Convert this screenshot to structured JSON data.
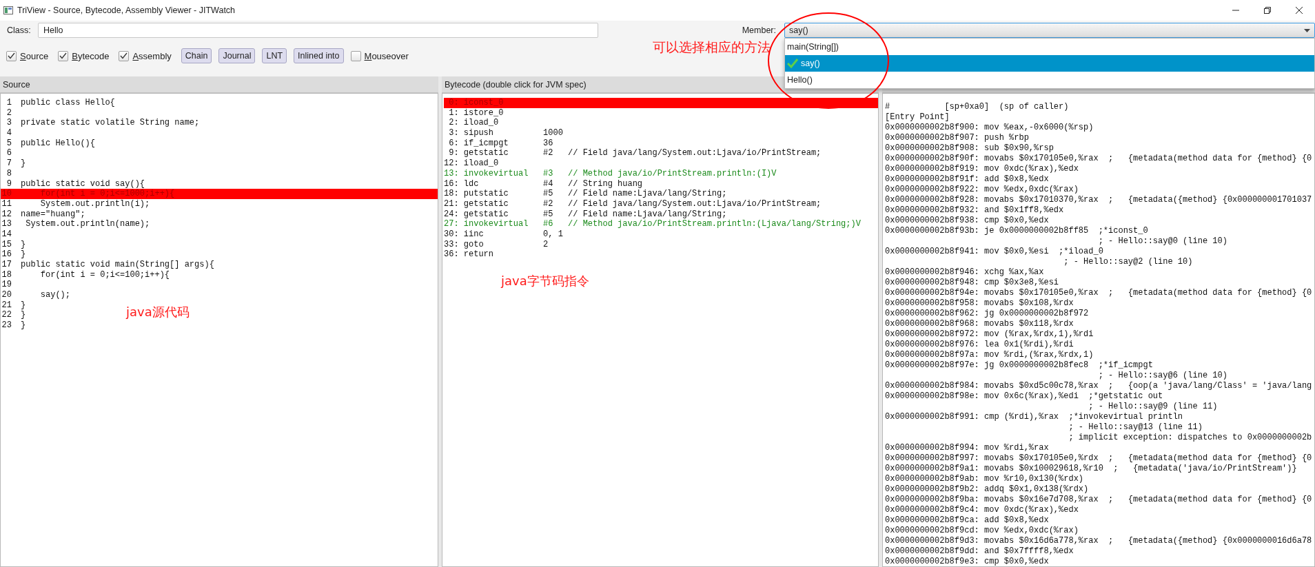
{
  "window": {
    "title": "TriView - Source, Bytecode, Assembly Viewer - JITWatch"
  },
  "class_field": {
    "label": "Class:",
    "value": "Hello"
  },
  "member": {
    "label": "Member:",
    "value": "say()",
    "expanded": true,
    "options": [
      {
        "label": "main(String[])",
        "selected": false
      },
      {
        "label": "say()",
        "selected": true
      },
      {
        "label": "Hello()",
        "selected": false
      }
    ]
  },
  "toolbar": [
    {
      "kind": "checkbox",
      "label": "Source",
      "checked": true
    },
    {
      "kind": "checkbox",
      "label": "Bytecode",
      "checked": true
    },
    {
      "kind": "checkbox",
      "label": "Assembly",
      "checked": true
    },
    {
      "kind": "button",
      "label": "Chain"
    },
    {
      "kind": "button",
      "label": "Journal"
    },
    {
      "kind": "button",
      "label": "LNT"
    },
    {
      "kind": "button",
      "label": "Inlined into"
    },
    {
      "kind": "checkbox",
      "label": "Mouseover",
      "checked": false
    }
  ],
  "annotation": {
    "text": "可以选择相应的方法"
  },
  "source": {
    "title": "Source",
    "note": "java源代码",
    "lines": [
      {
        "number": "1",
        "text": "public class Hello{",
        "highlighted": false
      },
      {
        "number": "2",
        "highlighted": false
      },
      {
        "number": "3",
        "text": "private static volatile String name;",
        "highlighted": false
      },
      {
        "number": "4",
        "highlighted": false
      },
      {
        "number": "5",
        "text": "public Hello(){",
        "highlighted": false
      },
      {
        "number": "6",
        "highlighted": false
      },
      {
        "number": "7",
        "text": "}",
        "highlighted": false
      },
      {
        "number": "8",
        "highlighted": false
      },
      {
        "number": "9",
        "text": "public static void say(){",
        "highlighted": false
      },
      {
        "number": "10",
        "text": "    for(int i = 0;i<=1000;i++){",
        "highlighted": true
      },
      {
        "number": "11",
        "text": "    System.out.println(i);",
        "highlighted": false
      },
      {
        "number": "12",
        "text": "name=\"huang\";",
        "highlighted": false
      },
      {
        "number": "13",
        "text": " System.out.println(name);",
        "highlighted": false
      },
      {
        "number": "14",
        "highlighted": false
      },
      {
        "number": "15",
        "text": "}",
        "highlighted": false
      },
      {
        "number": "16",
        "text": "}",
        "highlighted": false
      },
      {
        "number": "17",
        "text": "public static void main(String[] args){",
        "highlighted": false
      },
      {
        "number": "18",
        "text": "    for(int i = 0;i<=100;i++){",
        "highlighted": false
      },
      {
        "number": "19",
        "highlighted": false
      },
      {
        "number": "20",
        "text": "    say();",
        "highlighted": false
      },
      {
        "number": "21",
        "text": "}",
        "highlighted": false
      },
      {
        "number": "22",
        "text": "}",
        "highlighted": false
      },
      {
        "number": "23",
        "text": "}",
        "highlighted": false
      }
    ]
  },
  "bytecode": {
    "title": "Bytecode (double click for JVM spec)",
    "note": "java字节码指令",
    "lines": [
      {
        "text": " 0: iconst_0",
        "kind": "plain",
        "highlighted": true
      },
      {
        "text": " 1: istore_0",
        "kind": "plain",
        "highlighted": false
      },
      {
        "text": " 2: iload_0",
        "kind": "plain",
        "highlighted": false
      },
      {
        "text": " 3: sipush          1000",
        "kind": "plain",
        "highlighted": false
      },
      {
        "text": " 6: if_icmpgt       36",
        "kind": "plain",
        "highlighted": false
      },
      {
        "text": " 9: getstatic       #2   // Field java/lang/System.out:Ljava/io/PrintStream;",
        "kind": "plain",
        "highlighted": false
      },
      {
        "text": "12: iload_0",
        "kind": "plain",
        "highlighted": false
      },
      {
        "text": "13: invokevirtual   #3   // Method java/io/PrintStream.println:(I)V",
        "kind": "call",
        "highlighted": false
      },
      {
        "text": "16: ldc             #4   // String huang",
        "kind": "plain",
        "highlighted": false
      },
      {
        "text": "18: putstatic       #5   // Field name:Ljava/lang/String;",
        "kind": "plain",
        "highlighted": false
      },
      {
        "text": "21: getstatic       #2   // Field java/lang/System.out:Ljava/io/PrintStream;",
        "kind": "plain",
        "highlighted": false
      },
      {
        "text": "24: getstatic       #5   // Field name:Ljava/lang/String;",
        "kind": "plain",
        "highlighted": false
      },
      {
        "text": "27: invokevirtual   #6   // Method java/io/PrintStream.println:(Ljava/lang/String;)V",
        "kind": "call",
        "highlighted": false
      },
      {
        "text": "30: iinc            0, 1",
        "kind": "plain",
        "highlighted": false
      },
      {
        "text": "33: goto            2",
        "kind": "plain",
        "highlighted": false
      },
      {
        "text": "36: return",
        "kind": "plain",
        "highlighted": false
      }
    ]
  },
  "assembly": {
    "lines": [
      "#           [sp+0xa0]  (sp of caller)",
      "[Entry Point]",
      "0x0000000002b8f900: mov %eax,-0x6000(%rsp)",
      "0x0000000002b8f907: push %rbp",
      "0x0000000002b8f908: sub $0x90,%rsp",
      "0x0000000002b8f90f: movabs $0x170105e0,%rax  ;   {metadata(method data for {method} {0",
      "0x0000000002b8f919: mov 0xdc(%rax),%edx",
      "0x0000000002b8f91f: add $0x8,%edx",
      "0x0000000002b8f922: mov %edx,0xdc(%rax)",
      "0x0000000002b8f928: movabs $0x17010370,%rax  ;   {metadata({method} {0x000000001701037",
      "0x0000000002b8f932: and $0x1ff8,%edx",
      "0x0000000002b8f938: cmp $0x0,%edx",
      "0x0000000002b8f93b: je 0x0000000002b8ff85  ;*iconst_0",
      "                                           ; - Hello::say@0 (line 10)",
      "0x0000000002b8f941: mov $0x0,%esi  ;*iload_0",
      "                                    ; - Hello::say@2 (line 10)",
      "0x0000000002b8f946: xchg %ax,%ax",
      "0x0000000002b8f948: cmp $0x3e8,%esi",
      "0x0000000002b8f94e: movabs $0x170105e0,%rax  ;   {metadata(method data for {method} {0",
      "0x0000000002b8f958: movabs $0x108,%rdx",
      "0x0000000002b8f962: jg 0x0000000002b8f972",
      "0x0000000002b8f968: movabs $0x118,%rdx",
      "0x0000000002b8f972: mov (%rax,%rdx,1),%rdi",
      "0x0000000002b8f976: lea 0x1(%rdi),%rdi",
      "0x0000000002b8f97a: mov %rdi,(%rax,%rdx,1)",
      "0x0000000002b8f97e: jg 0x0000000002b8fec8  ;*if_icmpgt",
      "                                           ; - Hello::say@6 (line 10)",
      "0x0000000002b8f984: movabs $0xd5c00c78,%rax  ;   {oop(a 'java/lang/Class' = 'java/lang",
      "0x0000000002b8f98e: mov 0x6c(%rax),%edi  ;*getstatic out",
      "                                         ; - Hello::say@9 (line 11)",
      "0x0000000002b8f991: cmp (%rdi),%rax  ;*invokevirtual println",
      "                                     ; - Hello::say@13 (line 11)",
      "                                     ; implicit exception: dispatches to 0x0000000002b",
      "0x0000000002b8f994: mov %rdi,%rax",
      "0x0000000002b8f997: movabs $0x170105e0,%rdx  ;   {metadata(method data for {method} {0",
      "0x0000000002b8f9a1: movabs $0x100029618,%r10  ;   {metadata('java/io/PrintStream')}",
      "0x0000000002b8f9ab: mov %r10,0x130(%rdx)",
      "0x0000000002b8f9b2: addq $0x1,0x138(%rdx)",
      "0x0000000002b8f9ba: movabs $0x16e7d708,%rax  ;   {metadata(method data for {method} {0",
      "0x0000000002b8f9c4: mov 0xdc(%rax),%edx",
      "0x0000000002b8f9ca: add $0x8,%edx",
      "0x0000000002b8f9cd: mov %edx,0xdc(%rax)",
      "0x0000000002b8f9d3: movabs $0x16d6a778,%rax  ;   {metadata({method} {0x0000000016d6a78",
      "0x0000000002b8f9dd: and $0x7ffff8,%edx",
      "0x0000000002b8f9e3: cmp $0x0,%edx"
    ]
  }
}
